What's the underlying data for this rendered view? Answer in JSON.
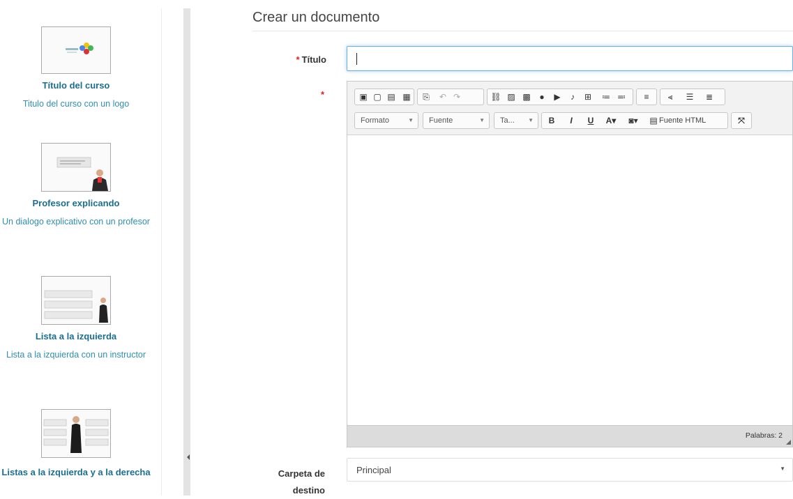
{
  "sidebar": {
    "templates": [
      {
        "title": "Título del curso",
        "description": "Titulo del curso con un logo"
      },
      {
        "title": "Profesor explicando",
        "description": "Un dialogo explicativo con un profesor"
      },
      {
        "title": "Lista a la izquierda",
        "description": "Lista a la izquierda con un instructor"
      },
      {
        "title": "Listas a la izquierda y a la derecha",
        "description": ""
      }
    ]
  },
  "form": {
    "page_title": "Crear un documento",
    "title_label": "Título",
    "title_value": "",
    "required_mark": "*",
    "folder_label": "Carpeta de destino",
    "folder_value": "Principal"
  },
  "editor": {
    "format_label": "Formato",
    "font_label": "Fuente",
    "size_label": "Ta...",
    "source_label": "Fuente HTML",
    "word_count": "Palabras: 2"
  },
  "colors": {
    "link": "#2e8fb2",
    "link_bold": "#1a6e92",
    "required": "#e02020",
    "focus": "#66afe9"
  }
}
